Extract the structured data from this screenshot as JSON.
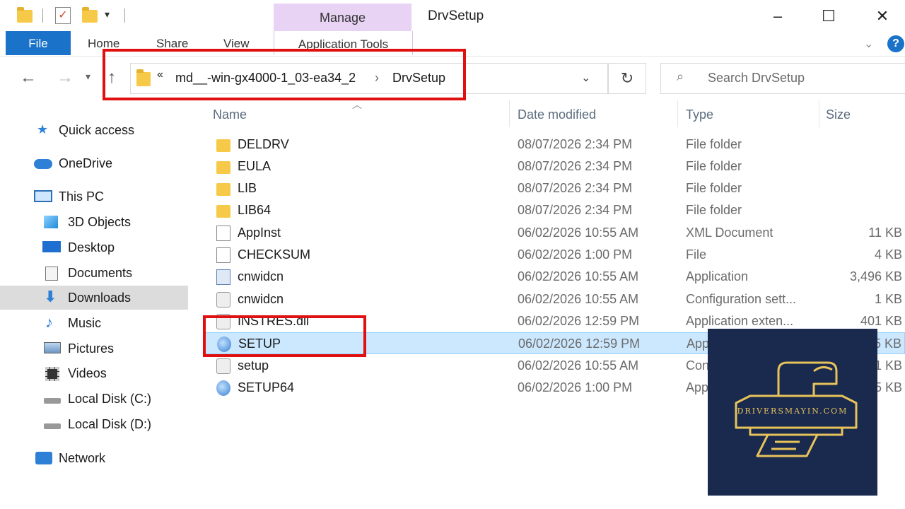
{
  "window": {
    "title": "DrvSetup",
    "manage_tab": "Manage",
    "minimize": "–",
    "maximize": "☐",
    "close": "✕"
  },
  "ribbon": {
    "file": "File",
    "tabs": [
      "Home",
      "Share",
      "View"
    ],
    "app_tools": "Application Tools",
    "help": "?"
  },
  "address": {
    "overflow": "«",
    "crumbs": [
      "md__-win-gx4000-1_03-ea34_2",
      "DrvSetup"
    ],
    "separator": "›",
    "search_placeholder": "Search DrvSetup"
  },
  "nav": [
    {
      "label": "Quick access",
      "icon": "star-icon"
    },
    {
      "label": "OneDrive",
      "icon": "cloud-icon"
    },
    {
      "label": "This PC",
      "icon": "computer-icon"
    },
    {
      "label": "3D Objects",
      "icon": "cube-icon"
    },
    {
      "label": "Desktop",
      "icon": "desktop-icon"
    },
    {
      "label": "Documents",
      "icon": "documents-icon"
    },
    {
      "label": "Downloads",
      "icon": "download-arrow-icon",
      "selected": true
    },
    {
      "label": "Music",
      "icon": "music-note-icon"
    },
    {
      "label": "Pictures",
      "icon": "pictures-icon"
    },
    {
      "label": "Videos",
      "icon": "film-icon"
    },
    {
      "label": "Local Disk (C:)",
      "icon": "drive-icon"
    },
    {
      "label": "Local Disk (D:)",
      "icon": "drive-icon"
    },
    {
      "label": "Network",
      "icon": "network-icon"
    }
  ],
  "columns": {
    "name": "Name",
    "date": "Date modified",
    "type": "Type",
    "size": "Size"
  },
  "files": [
    {
      "name": "DELDRV",
      "date": "08/07/2026 2:34 PM",
      "type": "File folder",
      "size": "",
      "icon": "folder"
    },
    {
      "name": "EULA",
      "date": "08/07/2026 2:34 PM",
      "type": "File folder",
      "size": "",
      "icon": "folder"
    },
    {
      "name": "LIB",
      "date": "08/07/2026 2:34 PM",
      "type": "File folder",
      "size": "",
      "icon": "folder"
    },
    {
      "name": "LIB64",
      "date": "08/07/2026 2:34 PM",
      "type": "File folder",
      "size": "",
      "icon": "folder"
    },
    {
      "name": "AppInst",
      "date": "06/02/2026 10:55 AM",
      "type": "XML Document",
      "size": "11 KB",
      "icon": "doc"
    },
    {
      "name": "CHECKSUM",
      "date": "06/02/2026 1:00 PM",
      "type": "File",
      "size": "4 KB",
      "icon": "doc"
    },
    {
      "name": "cnwidcn",
      "date": "06/02/2026 10:55 AM",
      "type": "Application",
      "size": "3,496 KB",
      "icon": "app"
    },
    {
      "name": "cnwidcn",
      "date": "06/02/2026 10:55 AM",
      "type": "Configuration sett...",
      "size": "1 KB",
      "icon": "cfg"
    },
    {
      "name": "INSTRES.dll",
      "date": "06/02/2026 12:59 PM",
      "type": "Application exten...",
      "size": "401 KB",
      "icon": "cfg"
    },
    {
      "name": "SETUP",
      "date": "06/02/2026 12:59 PM",
      "type": "App",
      "size": "5 KB",
      "icon": "setup",
      "selected": true
    },
    {
      "name": "setup",
      "date": "06/02/2026 10:55 AM",
      "type": "Con",
      "size": "1 KB",
      "icon": "cfg"
    },
    {
      "name": "SETUP64",
      "date": "06/02/2026 1:00 PM",
      "type": "App",
      "size": "5 KB",
      "icon": "setup"
    }
  ],
  "logo": {
    "text": "DRIVERSMAYIN.COM",
    "bg": "#1a2a4f",
    "accent": "#e7c35a"
  },
  "accent": "#1a73c8",
  "highlight_color": "#e01010"
}
